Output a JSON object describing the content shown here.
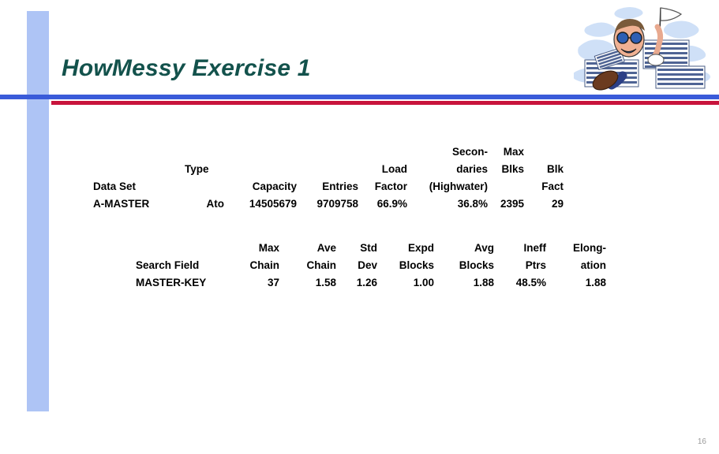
{
  "slide": {
    "title": "HowMessy Exercise 1",
    "slide_number": "16",
    "colors": {
      "title": "#13524c",
      "blue_rule": "#3a5bd9",
      "red_rule": "#c8143c",
      "left_bar": "#aec4f5",
      "slide_number": "#9a9a9a"
    }
  },
  "clipart": {
    "name": "person-buried-in-reports-waving-white-flag",
    "description": "Cartoon man buried under stacks of striped computer reports, waving a white surrender flag"
  },
  "dataset_table": {
    "headers_row1": {
      "name": "",
      "type": "",
      "capacity": "",
      "entries": "",
      "load": "",
      "secondaries": "Secon-",
      "maxblks": "Max",
      "blkfact": ""
    },
    "headers_row2": {
      "name": "",
      "type": "Type",
      "capacity": "",
      "entries": "",
      "load": "Load",
      "secondaries": "daries",
      "maxblks": "Blks",
      "blkfact": "Blk"
    },
    "headers_row3": {
      "name": "Data Set",
      "type": "",
      "capacity": "Capacity",
      "entries": "Entries",
      "load": "Factor",
      "secondaries": "(Highwater)",
      "maxblks": "",
      "blkfact": "Fact"
    },
    "row": {
      "name": "A-MASTER",
      "type": "Ato",
      "capacity": "14505679",
      "entries": "9709758",
      "load": "66.9%",
      "secondaries": "36.8%",
      "maxblks": "2395",
      "blkfact": "29"
    }
  },
  "search_table": {
    "headers_row1": {
      "name": "",
      "max_chain": "Max",
      "ave_chain": "Ave",
      "std_dev": "Std",
      "expd_blocks": "Expd",
      "avg_blocks": "Avg",
      "ineff_ptrs": "Ineff",
      "elongation": "Elong-"
    },
    "headers_row2": {
      "name": "Search Field",
      "max_chain": "Chain",
      "ave_chain": "Chain",
      "std_dev": "Dev",
      "expd_blocks": "Blocks",
      "avg_blocks": "Blocks",
      "ineff_ptrs": "Ptrs",
      "elongation": "ation"
    },
    "row": {
      "name": "MASTER-KEY",
      "max_chain": "37",
      "ave_chain": "1.58",
      "std_dev": "1.26",
      "expd_blocks": "1.00",
      "avg_blocks": "1.88",
      "ineff_ptrs": "48.5%",
      "elongation": "1.88"
    }
  }
}
